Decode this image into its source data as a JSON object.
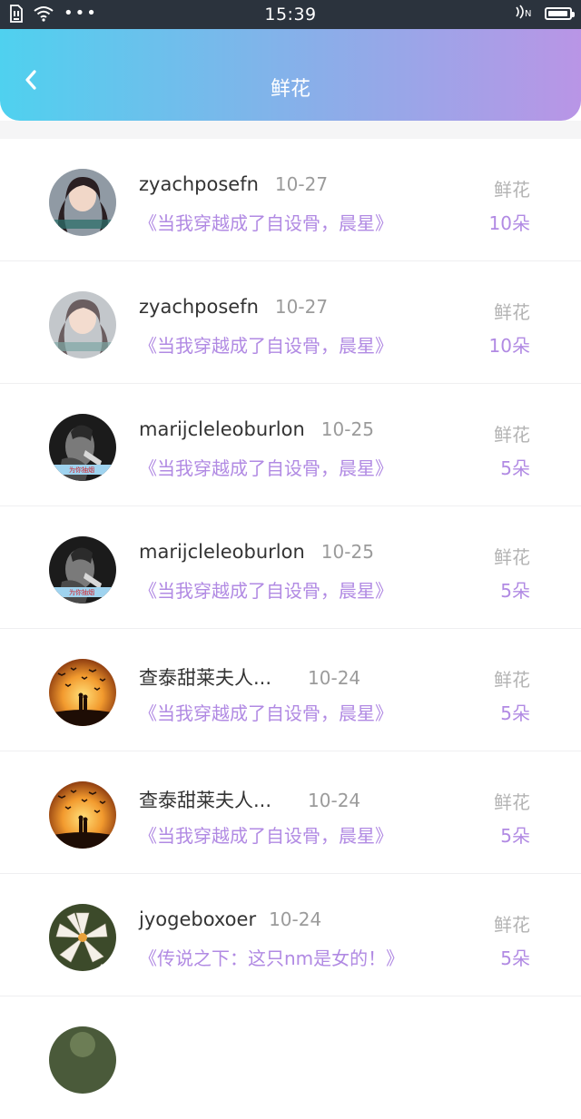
{
  "status_bar": {
    "time": "15:39",
    "battery_level": 0.95,
    "icons": [
      "sim-icon",
      "wifi-icon",
      "more-dots-icon",
      "nfc-icon",
      "battery-icon"
    ]
  },
  "header": {
    "title": "鲜花",
    "back_icon": "back-chevron-icon",
    "gradient_colors": [
      "#4fd1ef",
      "#b995e6"
    ]
  },
  "list": {
    "items": [
      {
        "username": "zyachposefn",
        "date": "10-27",
        "book": "《当我穿越成了自设骨，晨星》",
        "label": "鲜花",
        "count": "10朵",
        "avatar": "girl-portrait"
      },
      {
        "username": "zyachposefn",
        "date": "10-27",
        "book": "《当我穿越成了自设骨，晨星》",
        "label": "鲜花",
        "count": "10朵",
        "avatar": "girl-portrait"
      },
      {
        "username": "marijcleleoburlon",
        "date": "10-25",
        "book": "《当我穿越成了自设骨，晨星》",
        "label": "鲜花",
        "count": "5朵",
        "avatar": "smoking-man"
      },
      {
        "username": "marijcleleoburlon",
        "date": "10-25",
        "book": "《当我穿越成了自设骨，晨星》",
        "label": "鲜花",
        "count": "5朵",
        "avatar": "smoking-man"
      },
      {
        "username": "查泰甜莱夫人...",
        "date": "10-24",
        "book": "《当我穿越成了自设骨，晨星》",
        "label": "鲜花",
        "count": "5朵",
        "avatar": "sunset-birds"
      },
      {
        "username": "查泰甜莱夫人...",
        "date": "10-24",
        "book": "《当我穿越成了自设骨，晨星》",
        "label": "鲜花",
        "count": "5朵",
        "avatar": "sunset-birds"
      },
      {
        "username": "jyogeboxoer",
        "date": "10-24",
        "book": "《传说之下：这只nm是女的！》",
        "label": "鲜花",
        "count": "5朵",
        "avatar": "white-flower"
      }
    ]
  },
  "colors": {
    "accent_purple": "#b18ae3",
    "muted_gray": "#9b9b9b",
    "status_bar_bg": "#2b333d"
  }
}
